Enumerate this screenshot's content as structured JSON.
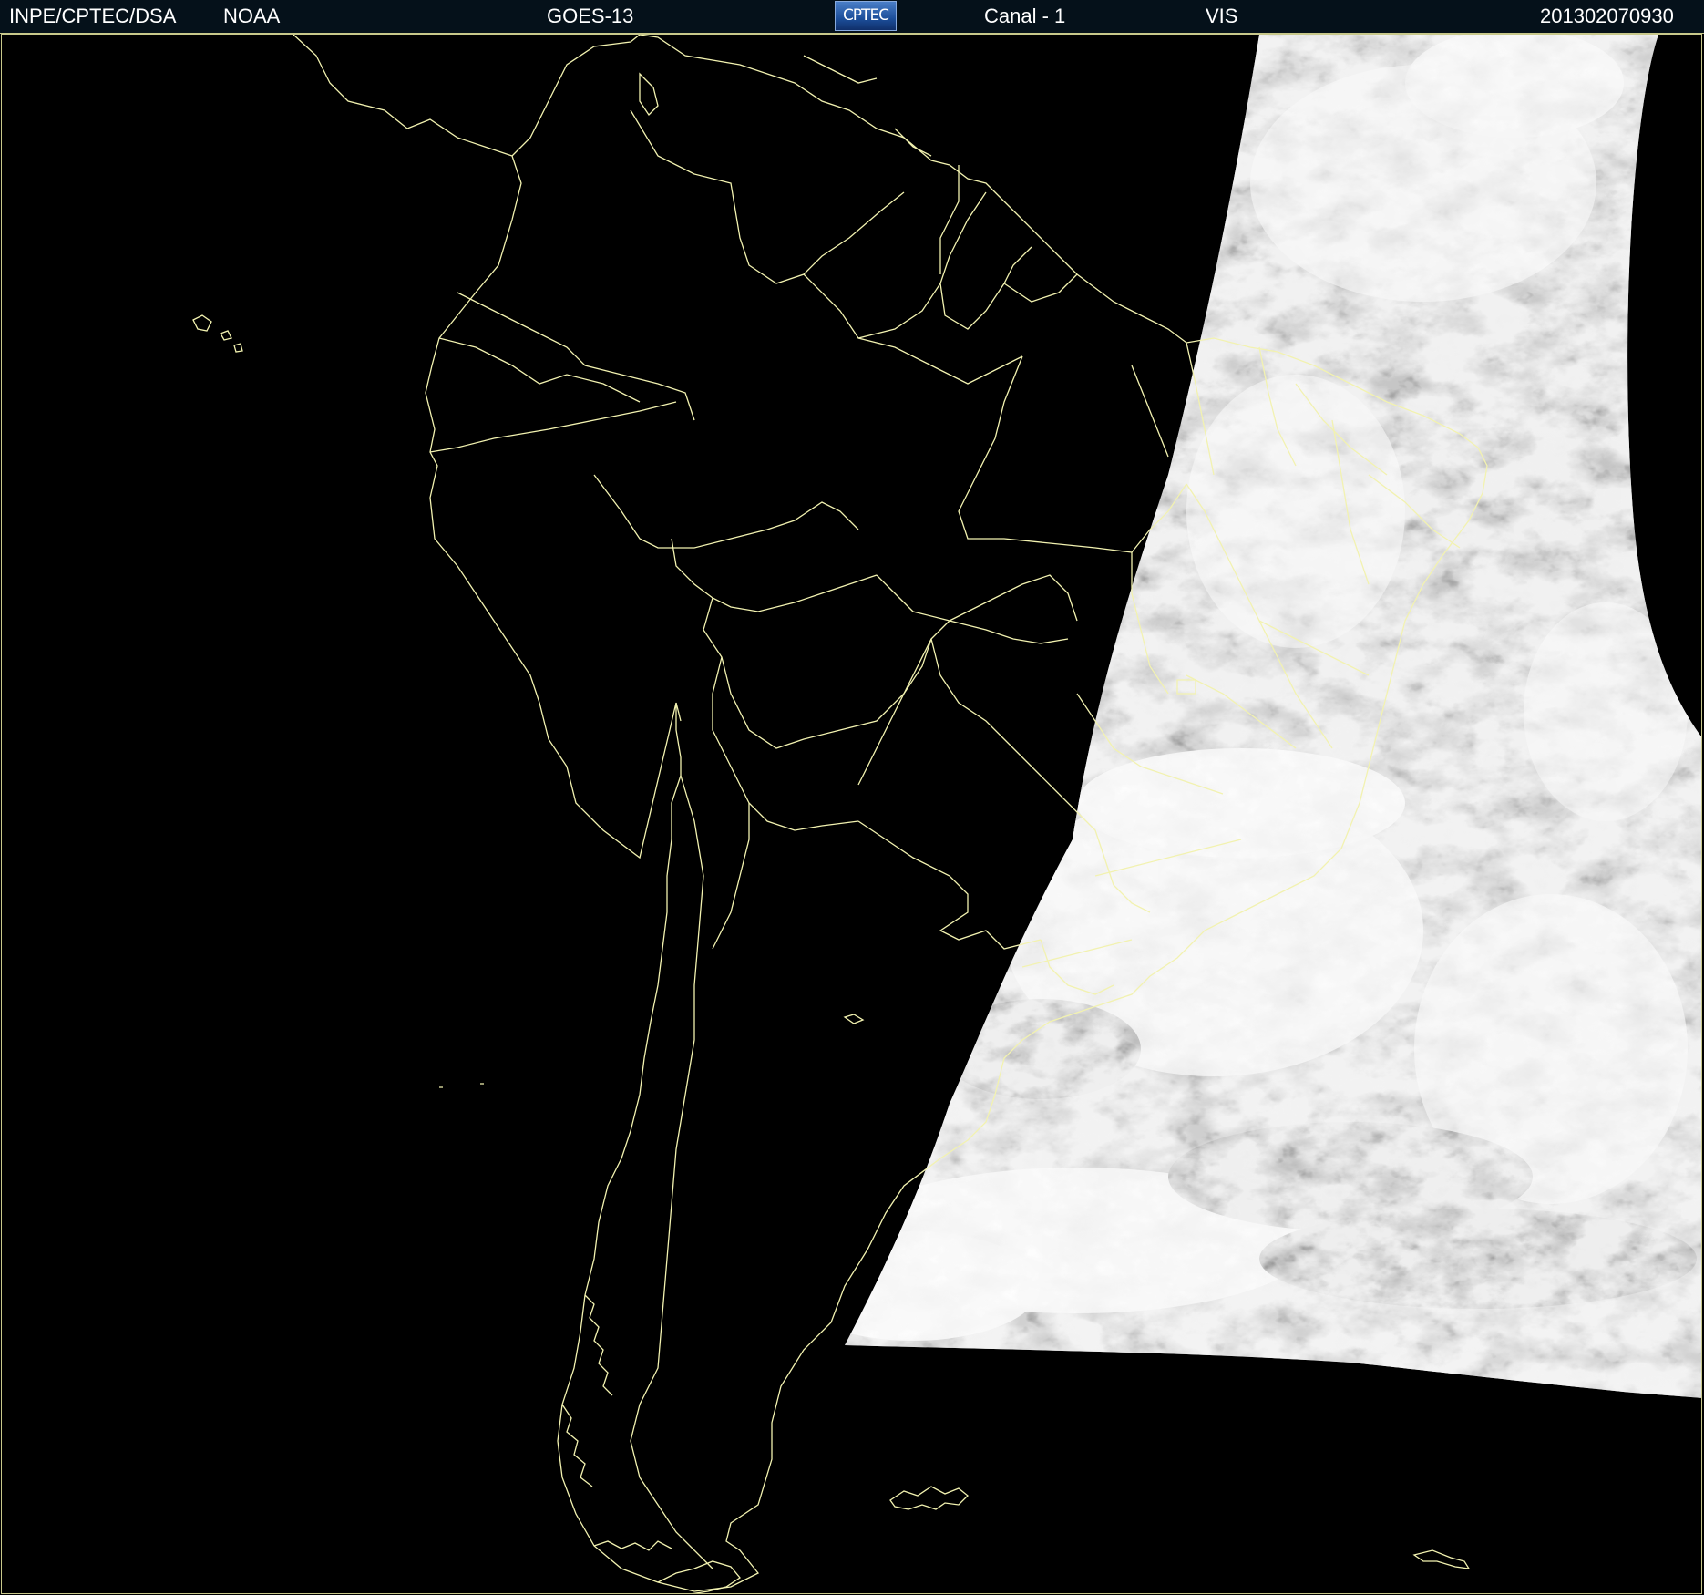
{
  "header": {
    "source": "INPE/CPTEC/DSA",
    "agency": "NOAA",
    "satellite": "GOES-13",
    "logo_text": "CPTEC",
    "channel": "Canal - 1",
    "band": "VIS",
    "timestamp": "201302070930"
  },
  "map": {
    "background_color": "#000000",
    "border_color": "#f2f2b0",
    "imagery_type": "visible-satellite-imagery",
    "region": "south-america"
  }
}
